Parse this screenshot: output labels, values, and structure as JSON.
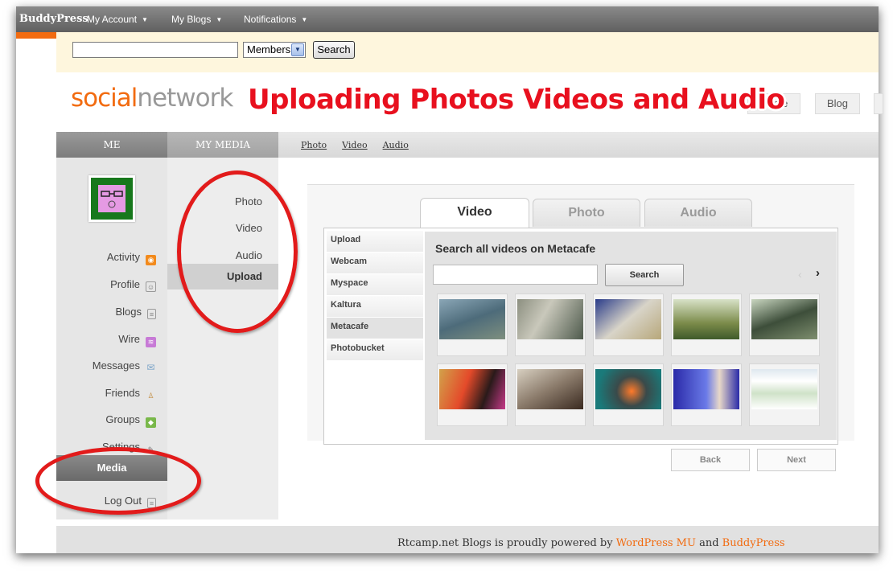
{
  "adminbar": {
    "brand": "BuddyPress",
    "menus": [
      {
        "label": "My Account"
      },
      {
        "label": "My Blogs"
      },
      {
        "label": "Notifications"
      }
    ]
  },
  "search": {
    "input_value": "",
    "scope_selected": "Members",
    "button_label": "Search"
  },
  "logo": {
    "part1": "social",
    "part2": "network"
  },
  "overlay_title": "Uploading Photos Videos and Audio",
  "topnav": [
    "Home",
    "Blog"
  ],
  "tabs": {
    "me": "ME",
    "media": "MY MEDIA"
  },
  "sublinks": [
    "Photo",
    "Video",
    "Audio"
  ],
  "leftnav": [
    {
      "label": "Activity",
      "icon": "rss-icon"
    },
    {
      "label": "Profile",
      "icon": "profile-icon"
    },
    {
      "label": "Blogs",
      "icon": "blog-icon"
    },
    {
      "label": "Wire",
      "icon": "wire-icon"
    },
    {
      "label": "Messages",
      "icon": "envelope-icon"
    },
    {
      "label": "Friends",
      "icon": "friends-icon"
    },
    {
      "label": "Groups",
      "icon": "groups-icon"
    },
    {
      "label": "Settings",
      "icon": "settings-icon"
    },
    {
      "label": "Media",
      "icon": ""
    },
    {
      "label": "Log Out",
      "icon": "logout-icon"
    }
  ],
  "midnav": [
    "Photo",
    "Video",
    "Audio",
    "Upload"
  ],
  "media_tabs": [
    "Video",
    "Photo",
    "Audio"
  ],
  "sources": [
    "Upload",
    "Webcam",
    "Myspace",
    "Kaltura",
    "Metacafe",
    "Photobucket"
  ],
  "pane": {
    "title": "Search all videos on Metacafe",
    "search_button": "Search",
    "prev_arrow": "‹",
    "next_arrow": "›"
  },
  "nav_buttons": {
    "back": "Back",
    "next": "Next"
  },
  "footer": {
    "text": "Rtcamp.net Blogs is proudly powered by ",
    "link1": "WordPress MU",
    "and": " and ",
    "link2": "BuddyPress"
  },
  "colors": {
    "accent": "#f26b10",
    "annotation_red": "#e21b1b"
  }
}
